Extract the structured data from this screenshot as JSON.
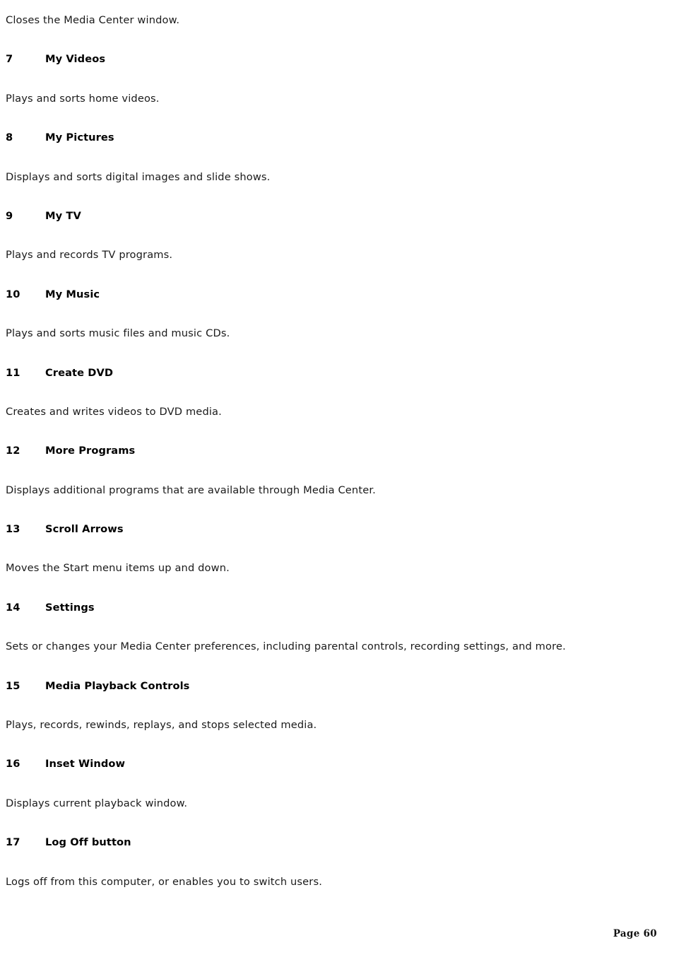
{
  "document": {
    "page_label": "Page 60",
    "intro_text": "Closes the Media Center window.",
    "entries": [
      {
        "number": "7",
        "label": "My Videos",
        "description": "Plays and sorts home videos."
      },
      {
        "number": "8",
        "label": "My Pictures",
        "description": "Displays and sorts digital images and slide shows."
      },
      {
        "number": "9",
        "label": "My TV",
        "description": "Plays and records TV programs."
      },
      {
        "number": "10",
        "label": "My Music",
        "description": "Plays and sorts music files and music CDs."
      },
      {
        "number": "11",
        "label": "Create DVD",
        "description": "Creates and writes videos to DVD media."
      },
      {
        "number": "12",
        "label": "More Programs",
        "description": "Displays additional programs that are available through Media Center."
      },
      {
        "number": "13",
        "label": "Scroll Arrows",
        "description": "Moves the Start menu items up and down."
      },
      {
        "number": "14",
        "label": "Settings",
        "description": "Sets or changes your Media Center preferences, including parental controls, recording settings, and more."
      },
      {
        "number": "15",
        "label": "Media Playback Controls",
        "description": "Plays, records, rewinds, replays, and stops selected media."
      },
      {
        "number": "16",
        "label": "Inset Window",
        "description": "Displays current playback window."
      },
      {
        "number": "17",
        "label": "Log Off button",
        "description": "Logs off from this computer, or enables you to switch users."
      }
    ]
  }
}
